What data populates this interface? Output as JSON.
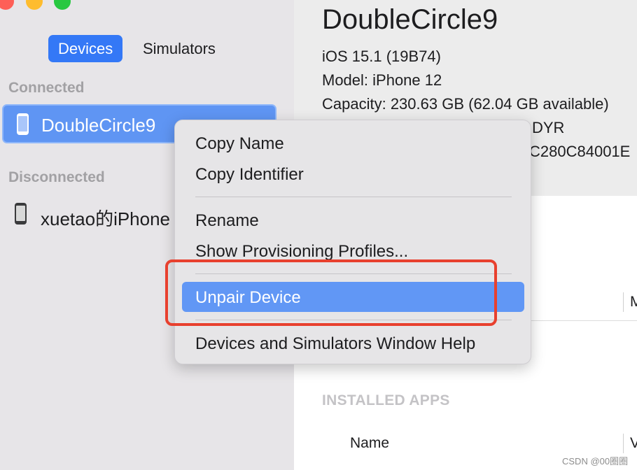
{
  "colors": {
    "sidebar_bg": "#e7e5e8",
    "accent": "#3478f6",
    "selection": "#5f95f3",
    "menu_highlight": "#6197f5",
    "annotation_red": "#e8402e",
    "traffic_close": "#fe5f57",
    "traffic_minimize": "#febc2e",
    "traffic_zoom": "#28c840"
  },
  "sidebar": {
    "tabs": [
      {
        "label": "Devices",
        "active": true
      },
      {
        "label": "Simulators",
        "active": false
      }
    ],
    "connected_title": "Connected",
    "connected_devices": [
      {
        "name": "DoubleCircle9",
        "icon": "iphone-icon",
        "selected": true
      }
    ],
    "disconnected_title": "Disconnected",
    "disconnected_devices": [
      {
        "name": "xuetao的iPhone",
        "icon": "iphone-icon",
        "selected": false
      }
    ]
  },
  "device": {
    "name": "DoubleCircle9",
    "ios": "iOS 15.1 (19B74)",
    "model": "Model: iPhone 12",
    "capacity": "Capacity: 230.63 GB (62.04 GB available)",
    "serial_partial": "DYR",
    "identifier_partial": "C280C84001E"
  },
  "installed_apps": {
    "title": "INSTALLED APPS",
    "column_name": "Name",
    "column_partial": "V",
    "upper_column_partial": "M"
  },
  "context_menu": {
    "items": [
      {
        "label": "Copy Name"
      },
      {
        "label": "Copy Identifier"
      },
      {
        "label": "Rename"
      },
      {
        "label": "Show Provisioning Profiles..."
      },
      {
        "label": "Unpair Device",
        "highlighted": true
      },
      {
        "label": "Devices and Simulators Window Help"
      }
    ]
  },
  "watermark": "CSDN @00圈圈"
}
